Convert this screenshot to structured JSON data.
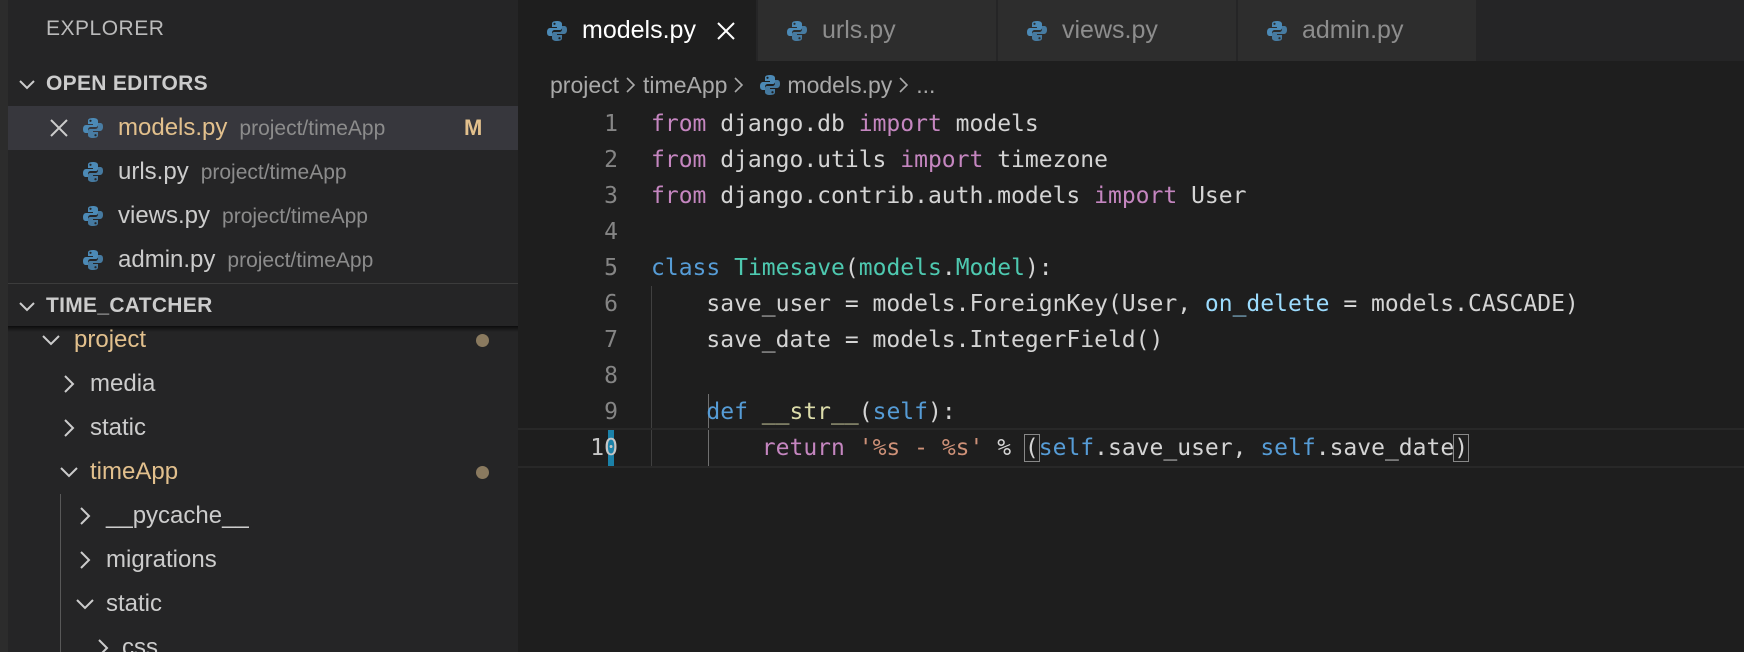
{
  "sidebar": {
    "title": "EXPLORER",
    "open_editors": {
      "header": "OPEN EDITORS",
      "items": [
        {
          "name": "models.py",
          "path": "project/timeApp",
          "badge": "M"
        },
        {
          "name": "urls.py",
          "path": "project/timeApp"
        },
        {
          "name": "views.py",
          "path": "project/timeApp"
        },
        {
          "name": "admin.py",
          "path": "project/timeApp"
        }
      ]
    },
    "workspace": {
      "header": "TIME_CATCHER",
      "tree": [
        {
          "label": "project",
          "expanded": true,
          "modified": true
        },
        {
          "label": "media",
          "expanded": false
        },
        {
          "label": "static",
          "expanded": false
        },
        {
          "label": "timeApp",
          "expanded": true,
          "modified": true
        },
        {
          "label": "__pycache__",
          "expanded": false
        },
        {
          "label": "migrations",
          "expanded": false
        },
        {
          "label": "static",
          "expanded": true
        },
        {
          "label": "css",
          "expanded": false
        }
      ]
    }
  },
  "tabs": [
    {
      "label": "models.py",
      "active": true
    },
    {
      "label": "urls.py"
    },
    {
      "label": "views.py"
    },
    {
      "label": "admin.py"
    }
  ],
  "breadcrumb": {
    "part1": "project",
    "part2": "timeApp",
    "part3": "models.py",
    "part4": "..."
  },
  "editor": {
    "current_line": 10,
    "lines": [
      {
        "n": "1",
        "code": "from django.db import models"
      },
      {
        "n": "2",
        "code": "from django.utils import timezone"
      },
      {
        "n": "3",
        "code": "from django.contrib.auth.models import User"
      },
      {
        "n": "4",
        "code": ""
      },
      {
        "n": "5",
        "code": "class Timesave(models.Model):"
      },
      {
        "n": "6",
        "code": "    save_user = models.ForeignKey(User, on_delete = models.CASCADE)"
      },
      {
        "n": "7",
        "code": "    save_date = models.IntegerField()"
      },
      {
        "n": "8",
        "code": ""
      },
      {
        "n": "9",
        "code": "    def __str__(self):"
      },
      {
        "n": "10",
        "code": "        return '%s - %s' % (self.save_user, self.save_date)"
      }
    ]
  },
  "colors": {
    "keyword": "#c586c0",
    "keyword_blue": "#569cd6",
    "class": "#4ec9b0",
    "function": "#dcdcaa",
    "parameter": "#9cdcfe",
    "string": "#ce9178",
    "modified": "#e2c08d"
  }
}
